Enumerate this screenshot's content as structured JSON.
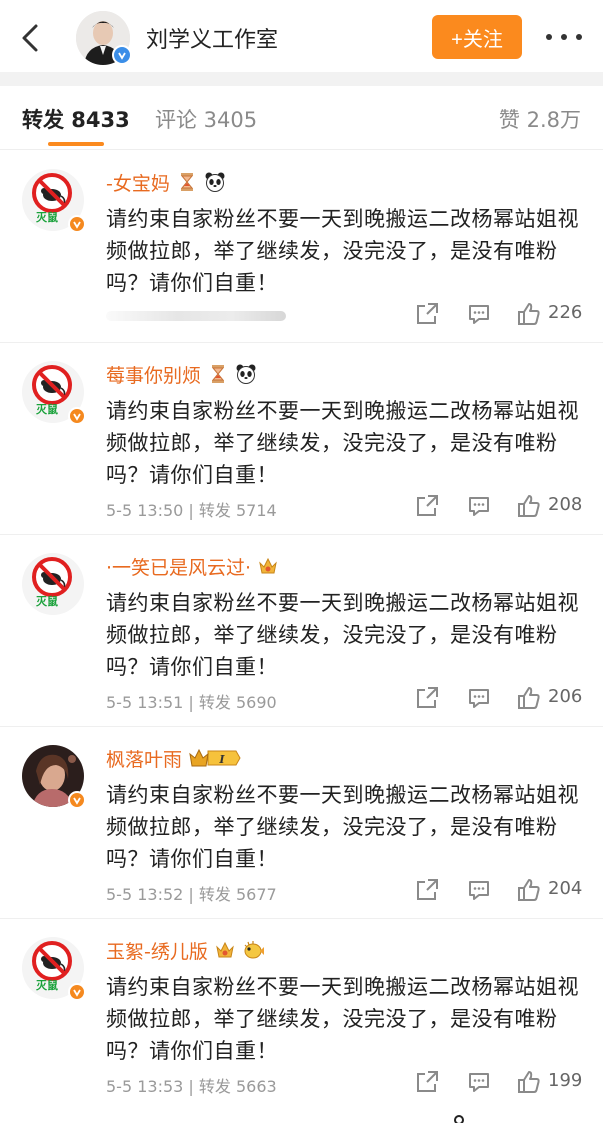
{
  "header": {
    "title": "刘学义工作室",
    "follow_label": "+关注",
    "back_icon": "back-icon",
    "more_icon": "more-icon"
  },
  "tabs": {
    "repost": "转发 8433",
    "comment": "评论 3405",
    "likes": "赞 2.8万"
  },
  "colors": {
    "accent": "#fb8a1e",
    "username": "#e86a20",
    "verified_blue": "#3b8ee8",
    "verified_orange": "#f5891f"
  },
  "items": [
    {
      "username": "-女宝妈",
      "badges": [
        "hourglass-icon",
        "panda-icon"
      ],
      "avatar_label": "灭鼠",
      "text": "请约束自家粉丝不要一天到晚搬运二改杨幂站姐视频做拉郎，举了继续发，没完没了，是没有唯粉吗？请你们自重！",
      "meta": "",
      "likes": "226"
    },
    {
      "username": "莓事你别烦",
      "badges": [
        "hourglass-icon",
        "panda-icon"
      ],
      "avatar_label": "灭鼠",
      "text": "请约束自家粉丝不要一天到晚搬运二改杨幂站姐视频做拉郎，举了继续发，没完没了，是没有唯粉吗？请你们自重！",
      "meta": "5-5 13:50 | 转发 5714",
      "likes": "208"
    },
    {
      "username": "·一笑已是风云过·",
      "badges": [
        "crown-badge-icon"
      ],
      "avatar_label": "灭鼠",
      "text": "请约束自家粉丝不要一天到晚搬运二改杨幂站姐视频做拉郎，举了继续发，没完没了，是没有唯粉吗？请你们自重！",
      "meta": "5-5 13:51 | 转发 5690",
      "likes": "206"
    },
    {
      "username": "枫落叶雨",
      "badges": [
        "vip-level-icon"
      ],
      "avatar_label": "",
      "text": "请约束自家粉丝不要一天到晚搬运二改杨幂站姐视频做拉郎，举了继续发，没完没了，是没有唯粉吗？请你们自重！",
      "meta": "5-5 13:52 | 转发 5677",
      "likes": "204"
    },
    {
      "username": "玉絮-绣儿版",
      "badges": [
        "crown-badge-icon",
        "pufferfish-icon"
      ],
      "avatar_label": "灭鼠",
      "text": "请约束自家粉丝不要一天到晚搬运二改杨幂站姐视频做拉郎，举了继续发，没完没了，是没有唯粉吗？请你们自重！",
      "meta": "5-5 13:53 | 转发 5663",
      "likes": "199"
    }
  ]
}
